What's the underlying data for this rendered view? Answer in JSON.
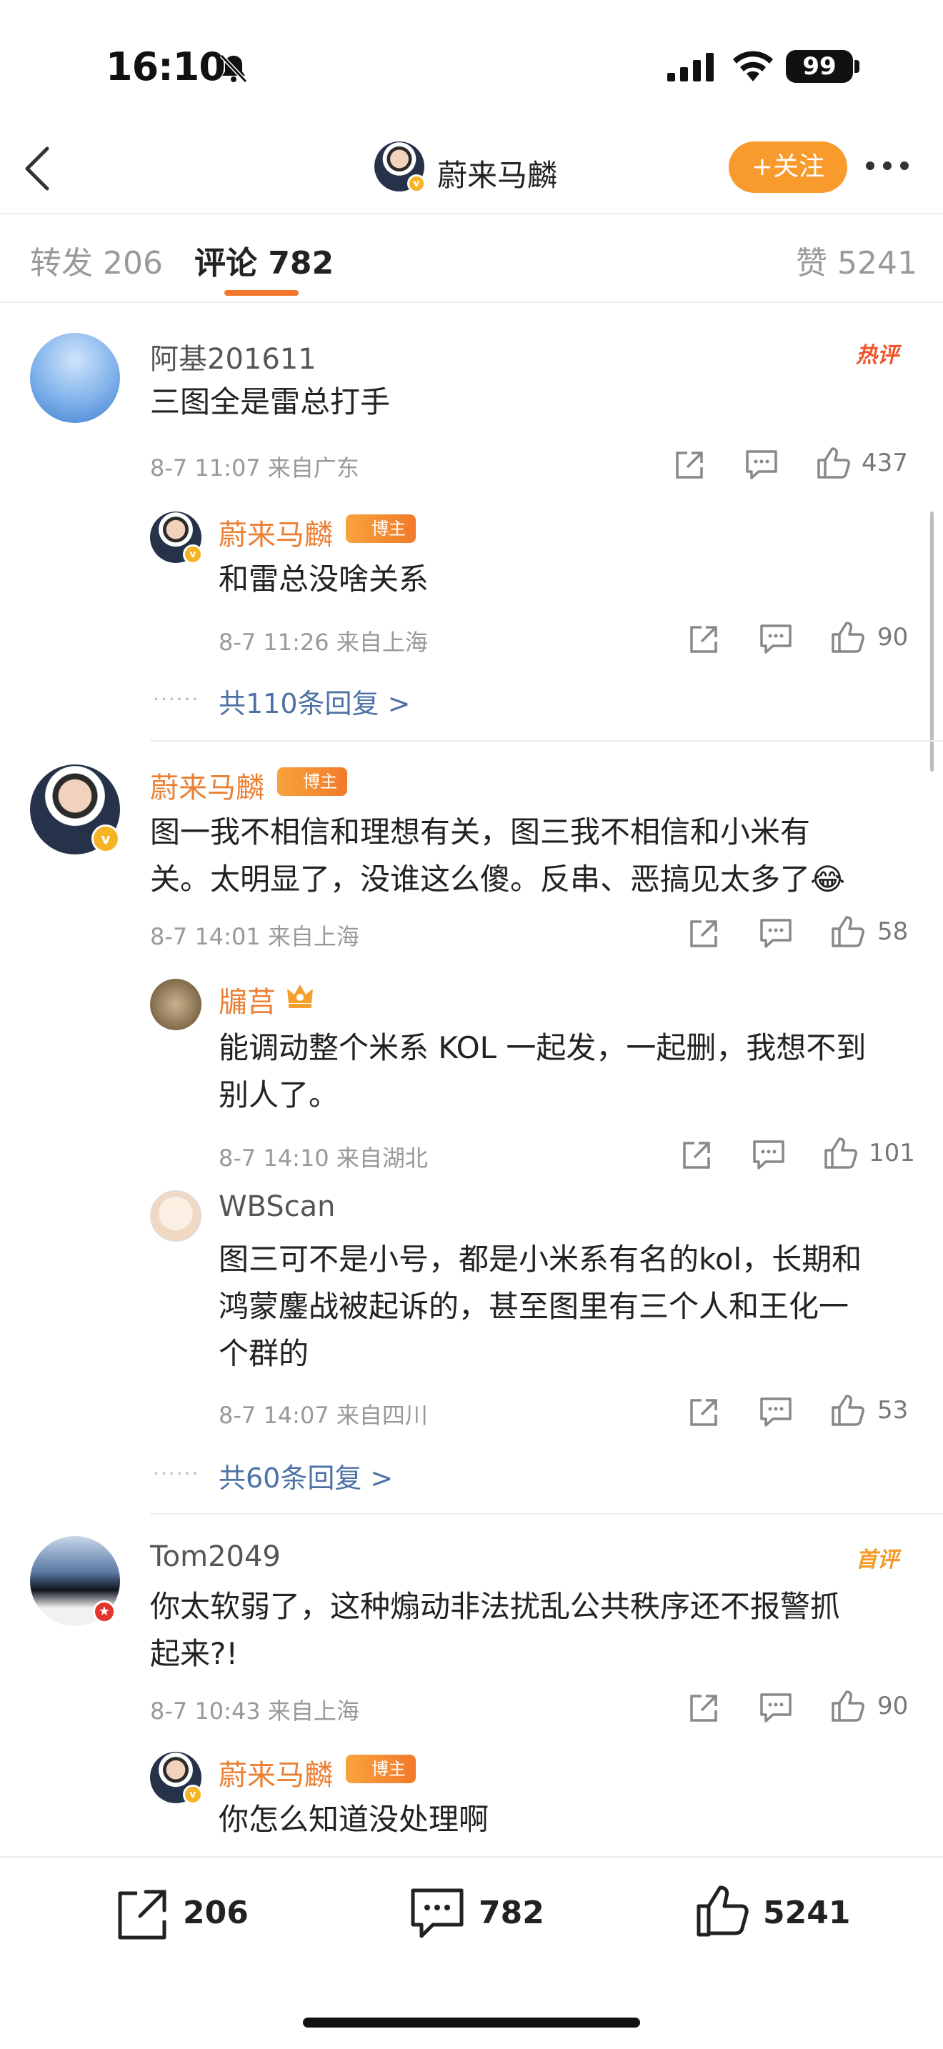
{
  "status_bar": {
    "time": "16:10",
    "battery": "99"
  },
  "header": {
    "name": "蔚来马麟",
    "follow_label": "+关注"
  },
  "tabs": {
    "repost": "转发 206",
    "comment": "评论 782",
    "like": "赞 5241"
  },
  "comments": [
    {
      "user": "阿基201611",
      "tag": "热评",
      "text": "三图全是雷总打手",
      "meta": "8-7 11:07 来自广东",
      "likes": "437",
      "replies": [
        {
          "user": "蔚来马麟",
          "badge": "博主",
          "text": "和雷总没啥关系",
          "meta": "8-7 11:26 来自上海",
          "likes": "90"
        }
      ],
      "more": "共110条回复 >"
    },
    {
      "user": "蔚来马麟",
      "badge": "博主",
      "text_lines": [
        "图一我不相信和理想有关，图三我不相信和小米有",
        "关。太明显了，没谁这么傻。反串、恶搞见太多了😂"
      ],
      "meta": "8-7 14:01 来自上海",
      "likes": "58",
      "replies": [
        {
          "user": "牖莒",
          "text_lines": [
            "能调动整个米系 KOL 一起发，一起删，我想不到",
            "别人了。"
          ],
          "meta": "8-7 14:10 来自湖北",
          "likes": "101"
        },
        {
          "user": "WBScan",
          "text_lines": [
            "图三可不是小号，都是小米系有名的kol，长期和",
            "鸿蒙鏖战被起诉的，甚至图里有三个人和王化一",
            "个群的"
          ],
          "meta": "8-7 14:07 来自四川",
          "likes": "53"
        }
      ],
      "more": "共60条回复 >"
    },
    {
      "user": "Tom2049",
      "tag": "首评",
      "text_lines": [
        "你太软弱了，这种煽动非法扰乱公共秩序还不报警抓",
        "起来?!"
      ],
      "meta": "8-7 10:43 来自上海",
      "likes": "90",
      "replies": [
        {
          "user": "蔚来马麟",
          "badge": "博主",
          "text": "你怎么知道没处理啊"
        }
      ]
    }
  ],
  "bottom_bar": {
    "repost": "206",
    "comment": "782",
    "like": "5241"
  },
  "colors": {
    "accent": "#f5772c",
    "follow": "#f89a2c",
    "link": "#4e72a6",
    "author": "#eb7f33"
  },
  "icons": [
    "back-icon",
    "more-icon",
    "share-icon",
    "comment-icon",
    "like-icon",
    "signal-icon",
    "wifi-icon",
    "mute-bell-icon"
  ]
}
